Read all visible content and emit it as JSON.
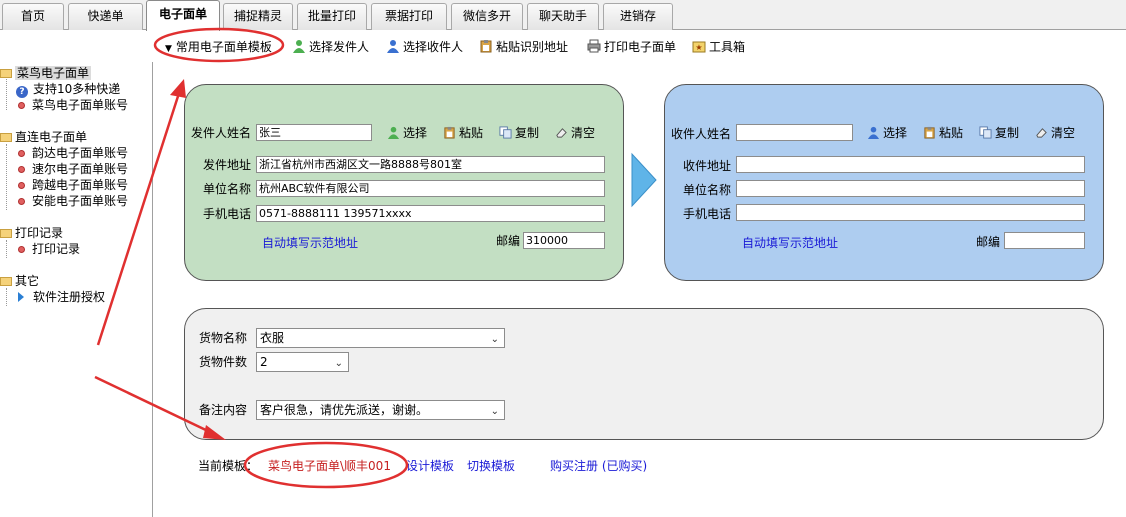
{
  "tabs": [
    {
      "label": "首页",
      "active": false
    },
    {
      "label": "快递单",
      "active": false
    },
    {
      "label": "电子面单",
      "active": true
    },
    {
      "label": "捕捉精灵",
      "active": false
    },
    {
      "label": "批量打印",
      "active": false
    },
    {
      "label": "票据打印",
      "active": false
    },
    {
      "label": "微信多开",
      "active": false
    },
    {
      "label": "聊天助手",
      "active": false
    },
    {
      "label": "进销存",
      "active": false
    }
  ],
  "toolbar": {
    "template_menu": "常用电子面单模板",
    "select_sender": "选择发件人",
    "select_receiver": "选择收件人",
    "paste_recognize": "粘贴识别地址",
    "print": "打印电子面单",
    "toolbox": "工具箱"
  },
  "sidebar": {
    "groups": [
      {
        "label": "菜鸟电子面单",
        "items": [
          "支持10多种快递",
          "菜鸟电子面单账号"
        ]
      },
      {
        "label": "直连电子面单",
        "items": [
          "韵达电子面单账号",
          "速尔电子面单账号",
          "跨越电子面单账号",
          "安能电子面单账号"
        ]
      },
      {
        "label": "打印记录",
        "items": [
          "打印记录"
        ]
      },
      {
        "label": "其它",
        "items": [
          "软件注册授权"
        ]
      }
    ]
  },
  "sender": {
    "name_label": "发件人姓名",
    "name_value": "张三",
    "select": "选择",
    "paste": "粘贴",
    "copy": "复制",
    "clear": "清空",
    "address_label": "发件地址",
    "address_value": "浙江省杭州市西湖区文一路8888号801室",
    "company_label": "单位名称",
    "company_value": "杭州ABC软件有限公司",
    "phone_label": "手机电话",
    "phone_value": "0571-8888111 139571xxxx",
    "autofill": "自动填写示范地址",
    "zip_label": "邮编",
    "zip_value": "310000"
  },
  "receiver": {
    "name_label": "收件人姓名",
    "name_value": "",
    "select": "选择",
    "paste": "粘贴",
    "copy": "复制",
    "clear": "清空",
    "address_label": "收件地址",
    "address_value": "",
    "company_label": "单位名称",
    "company_value": "",
    "phone_label": "手机电话",
    "phone_value": "",
    "autofill": "自动填写示范地址",
    "zip_label": "邮编",
    "zip_value": ""
  },
  "goods": {
    "name_label": "货物名称",
    "name_value": "衣服",
    "count_label": "货物件数",
    "count_value": "2",
    "note_label": "备注内容",
    "note_value": "客户很急，请优先派送，谢谢。"
  },
  "footer": {
    "current_template_label": "当前模板：",
    "current_template_value": "菜鸟电子面单\\顺丰001",
    "design_template": "设计模板",
    "switch_template": "切换模板",
    "buy_register": "购买注册 (已购买)"
  },
  "colors": {
    "sender_panel": "#c3dfc3",
    "receiver_panel": "#aecdf0",
    "goods_panel": "#f0f0f0",
    "link": "#1a1ad6",
    "annotation_red": "#e03030"
  }
}
